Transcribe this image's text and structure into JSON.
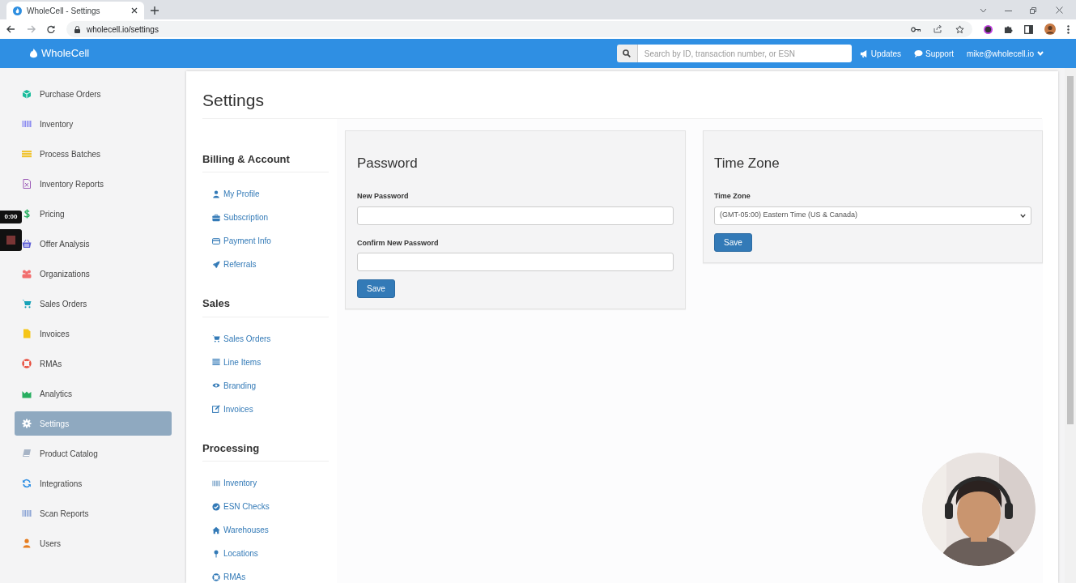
{
  "browser": {
    "tab_title": "WholeCell - Settings",
    "address": "wholecell.io/settings"
  },
  "header": {
    "brand": "WholeCell",
    "search": {
      "placeholder": "Search by ID, transaction number, or ESN"
    },
    "links": [
      "Updates",
      "Support"
    ],
    "account": "mike@wholecell.io"
  },
  "recorder": {
    "time": "0:00"
  },
  "sidebar": {
    "items": [
      {
        "label": "Purchase Orders",
        "selected": false
      },
      {
        "label": "Inventory",
        "selected": false
      },
      {
        "label": "Process Batches",
        "selected": false
      },
      {
        "label": "Inventory Reports",
        "selected": false
      },
      {
        "label": "Pricing",
        "selected": false
      },
      {
        "label": "Offer Analysis",
        "selected": false
      },
      {
        "label": "Organizations",
        "selected": false
      },
      {
        "label": "Sales Orders",
        "selected": false
      },
      {
        "label": "Invoices",
        "selected": false
      },
      {
        "label": "RMAs",
        "selected": false
      },
      {
        "label": "Analytics",
        "selected": false
      },
      {
        "label": "Settings",
        "selected": true
      },
      {
        "label": "Product Catalog",
        "selected": false
      },
      {
        "label": "Integrations",
        "selected": false
      },
      {
        "label": "Scan Reports",
        "selected": false
      },
      {
        "label": "Users",
        "selected": false
      }
    ]
  },
  "page": {
    "title": "Settings",
    "sections": [
      {
        "heading": "Billing & Account",
        "links": [
          "My Profile",
          "Subscription",
          "Payment Info",
          "Referrals"
        ]
      },
      {
        "heading": "Sales",
        "links": [
          "Sales Orders",
          "Line Items",
          "Branding",
          "Invoices"
        ]
      },
      {
        "heading": "Processing",
        "links": [
          "Inventory",
          "ESN Checks",
          "Warehouses",
          "Locations",
          "RMAs"
        ]
      }
    ],
    "password_card": {
      "title": "Password",
      "fields": [
        {
          "label": "New Password"
        },
        {
          "label": "Confirm New Password"
        }
      ],
      "button": "Save"
    },
    "timezone_card": {
      "title": "Time Zone",
      "label": "Time Zone",
      "value": "(GMT-05:00) Eastern Time (US & Canada)",
      "button": "Save"
    }
  }
}
